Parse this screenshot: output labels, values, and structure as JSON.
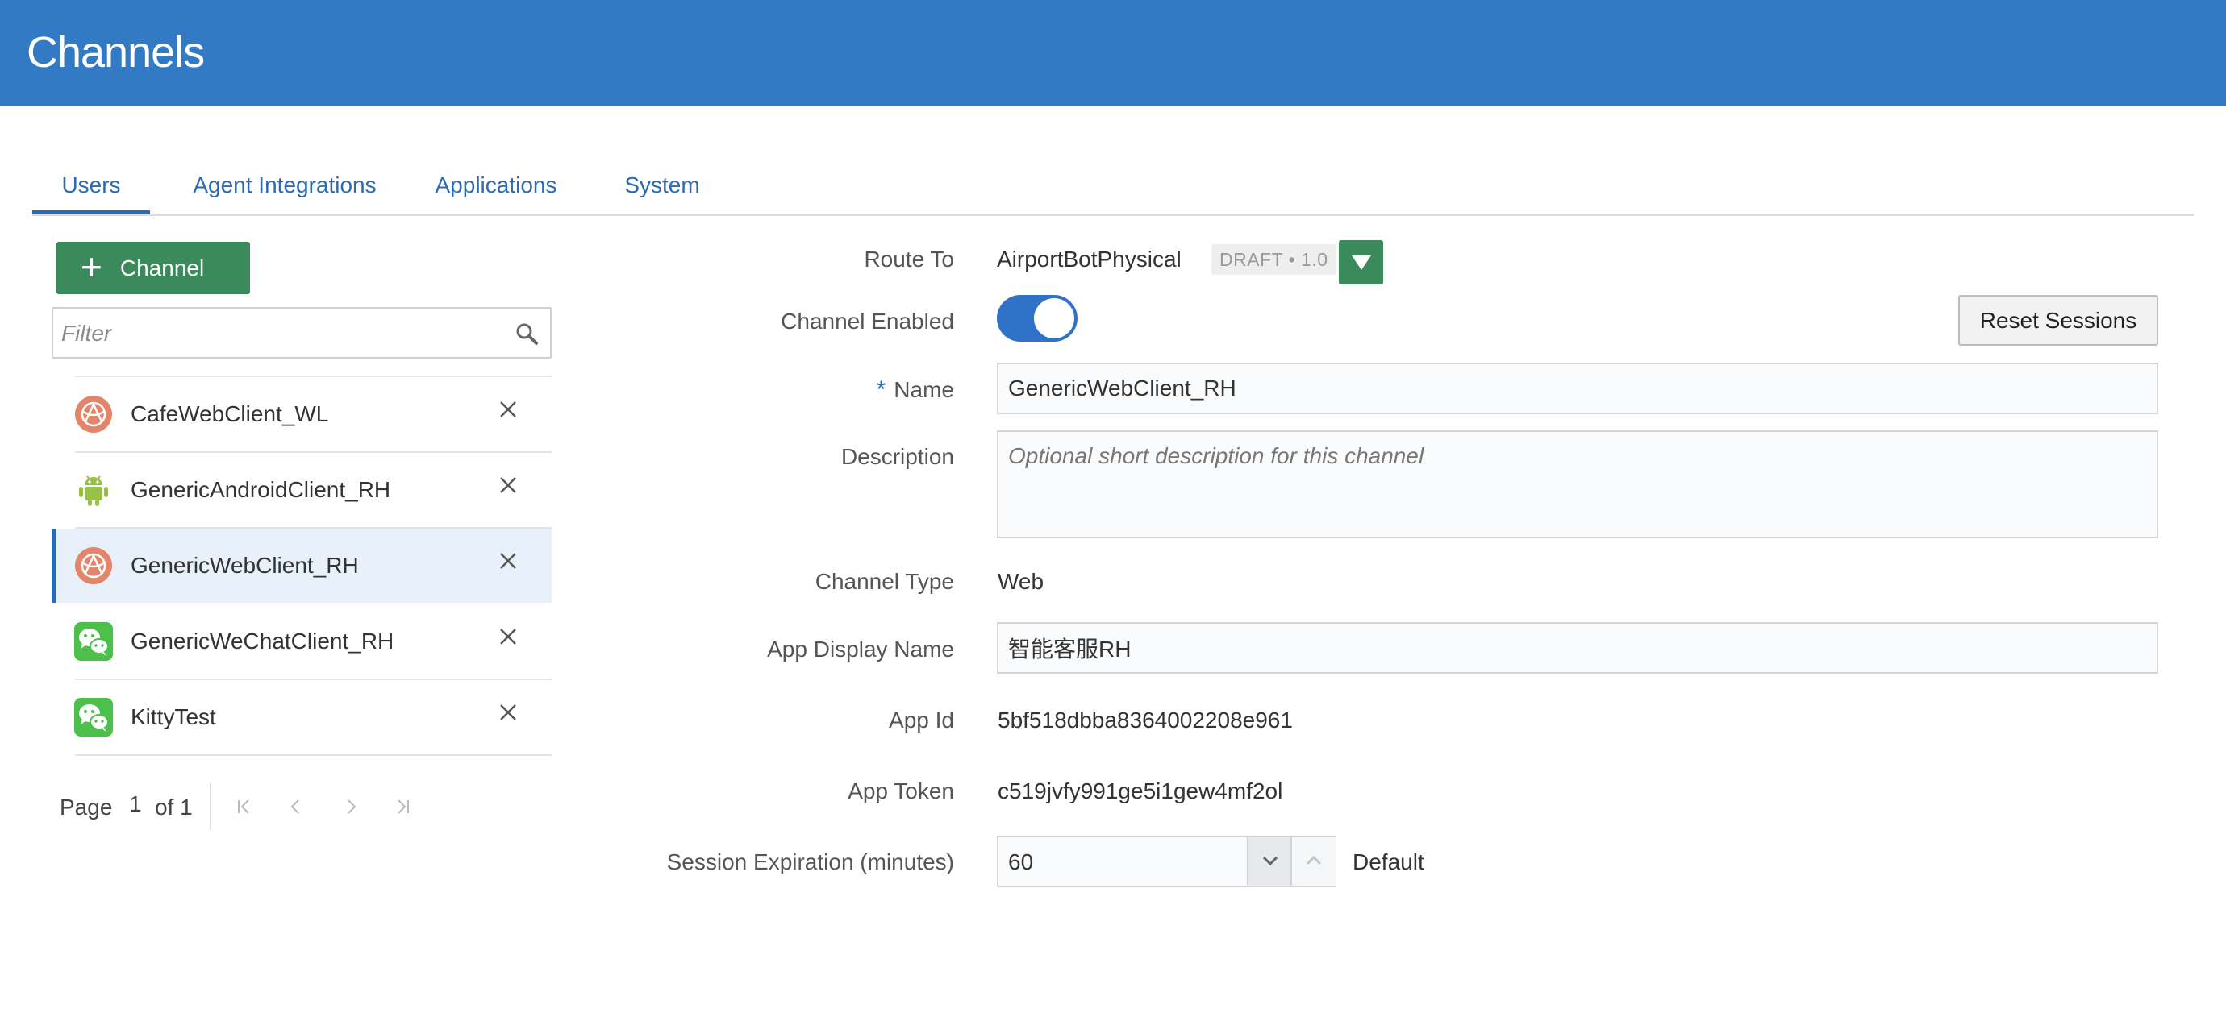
{
  "header": {
    "title": "Channels"
  },
  "tabs": [
    {
      "label": "Users",
      "active": true
    },
    {
      "label": "Agent Integrations",
      "active": false
    },
    {
      "label": "Applications",
      "active": false
    },
    {
      "label": "System",
      "active": false
    }
  ],
  "sidebar": {
    "add_button_label": "Channel",
    "filter_placeholder": "Filter",
    "items": [
      {
        "label": "CafeWebClient_WL",
        "icon": "web-channel-icon",
        "selected": false
      },
      {
        "label": "GenericAndroidClient_RH",
        "icon": "android-icon",
        "selected": false
      },
      {
        "label": "GenericWebClient_RH",
        "icon": "web-channel-icon",
        "selected": true
      },
      {
        "label": "GenericWeChatClient_RH",
        "icon": "wechat-icon",
        "selected": false
      },
      {
        "label": "KittyTest",
        "icon": "wechat-icon",
        "selected": false
      }
    ],
    "pager": {
      "page_label": "Page",
      "current": "1",
      "of_label": "of 1"
    }
  },
  "form": {
    "route_to": {
      "label": "Route To",
      "value": "AirportBotPhysical",
      "badge": "DRAFT • 1.0"
    },
    "channel_enabled": {
      "label": "Channel Enabled",
      "enabled": true
    },
    "reset_sessions_label": "Reset Sessions",
    "name": {
      "label": "Name",
      "required_mark": "*",
      "value": "GenericWebClient_RH"
    },
    "description": {
      "label": "Description",
      "placeholder": "Optional short description for this channel",
      "value": ""
    },
    "channel_type": {
      "label": "Channel Type",
      "value": "Web"
    },
    "app_display_name": {
      "label": "App Display Name",
      "value": "智能客服RH"
    },
    "app_id": {
      "label": "App Id",
      "value": "5bf518dbba8364002208e961"
    },
    "app_token": {
      "label": "App Token",
      "value": "c519jvfy991ge5i1gew4mf2ol"
    },
    "session_expiration": {
      "label": "Session Expiration (minutes)",
      "value": "60",
      "default_label": "Default"
    }
  },
  "colors": {
    "header_bg": "#337ac4",
    "accent": "#2b6bb5",
    "green_button": "#3a8a5c",
    "toggle_on": "#2f72c7",
    "selected_row_bg": "#e8f1fa"
  }
}
